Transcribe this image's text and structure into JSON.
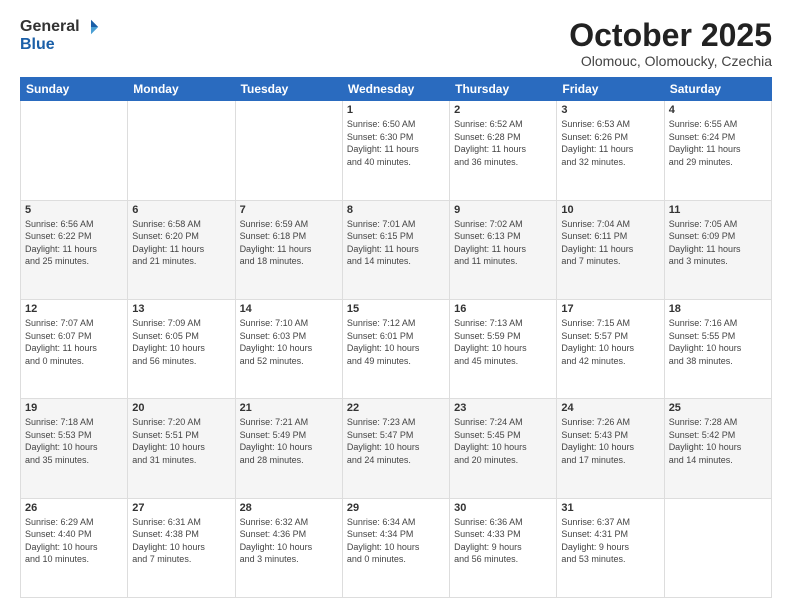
{
  "logo": {
    "general": "General",
    "blue": "Blue"
  },
  "header": {
    "month_year": "October 2025",
    "location": "Olomouc, Olomoucky, Czechia"
  },
  "days_of_week": [
    "Sunday",
    "Monday",
    "Tuesday",
    "Wednesday",
    "Thursday",
    "Friday",
    "Saturday"
  ],
  "weeks": [
    [
      {
        "day": "",
        "info": ""
      },
      {
        "day": "",
        "info": ""
      },
      {
        "day": "",
        "info": ""
      },
      {
        "day": "1",
        "info": "Sunrise: 6:50 AM\nSunset: 6:30 PM\nDaylight: 11 hours\nand 40 minutes."
      },
      {
        "day": "2",
        "info": "Sunrise: 6:52 AM\nSunset: 6:28 PM\nDaylight: 11 hours\nand 36 minutes."
      },
      {
        "day": "3",
        "info": "Sunrise: 6:53 AM\nSunset: 6:26 PM\nDaylight: 11 hours\nand 32 minutes."
      },
      {
        "day": "4",
        "info": "Sunrise: 6:55 AM\nSunset: 6:24 PM\nDaylight: 11 hours\nand 29 minutes."
      }
    ],
    [
      {
        "day": "5",
        "info": "Sunrise: 6:56 AM\nSunset: 6:22 PM\nDaylight: 11 hours\nand 25 minutes."
      },
      {
        "day": "6",
        "info": "Sunrise: 6:58 AM\nSunset: 6:20 PM\nDaylight: 11 hours\nand 21 minutes."
      },
      {
        "day": "7",
        "info": "Sunrise: 6:59 AM\nSunset: 6:18 PM\nDaylight: 11 hours\nand 18 minutes."
      },
      {
        "day": "8",
        "info": "Sunrise: 7:01 AM\nSunset: 6:15 PM\nDaylight: 11 hours\nand 14 minutes."
      },
      {
        "day": "9",
        "info": "Sunrise: 7:02 AM\nSunset: 6:13 PM\nDaylight: 11 hours\nand 11 minutes."
      },
      {
        "day": "10",
        "info": "Sunrise: 7:04 AM\nSunset: 6:11 PM\nDaylight: 11 hours\nand 7 minutes."
      },
      {
        "day": "11",
        "info": "Sunrise: 7:05 AM\nSunset: 6:09 PM\nDaylight: 11 hours\nand 3 minutes."
      }
    ],
    [
      {
        "day": "12",
        "info": "Sunrise: 7:07 AM\nSunset: 6:07 PM\nDaylight: 11 hours\nand 0 minutes."
      },
      {
        "day": "13",
        "info": "Sunrise: 7:09 AM\nSunset: 6:05 PM\nDaylight: 10 hours\nand 56 minutes."
      },
      {
        "day": "14",
        "info": "Sunrise: 7:10 AM\nSunset: 6:03 PM\nDaylight: 10 hours\nand 52 minutes."
      },
      {
        "day": "15",
        "info": "Sunrise: 7:12 AM\nSunset: 6:01 PM\nDaylight: 10 hours\nand 49 minutes."
      },
      {
        "day": "16",
        "info": "Sunrise: 7:13 AM\nSunset: 5:59 PM\nDaylight: 10 hours\nand 45 minutes."
      },
      {
        "day": "17",
        "info": "Sunrise: 7:15 AM\nSunset: 5:57 PM\nDaylight: 10 hours\nand 42 minutes."
      },
      {
        "day": "18",
        "info": "Sunrise: 7:16 AM\nSunset: 5:55 PM\nDaylight: 10 hours\nand 38 minutes."
      }
    ],
    [
      {
        "day": "19",
        "info": "Sunrise: 7:18 AM\nSunset: 5:53 PM\nDaylight: 10 hours\nand 35 minutes."
      },
      {
        "day": "20",
        "info": "Sunrise: 7:20 AM\nSunset: 5:51 PM\nDaylight: 10 hours\nand 31 minutes."
      },
      {
        "day": "21",
        "info": "Sunrise: 7:21 AM\nSunset: 5:49 PM\nDaylight: 10 hours\nand 28 minutes."
      },
      {
        "day": "22",
        "info": "Sunrise: 7:23 AM\nSunset: 5:47 PM\nDaylight: 10 hours\nand 24 minutes."
      },
      {
        "day": "23",
        "info": "Sunrise: 7:24 AM\nSunset: 5:45 PM\nDaylight: 10 hours\nand 20 minutes."
      },
      {
        "day": "24",
        "info": "Sunrise: 7:26 AM\nSunset: 5:43 PM\nDaylight: 10 hours\nand 17 minutes."
      },
      {
        "day": "25",
        "info": "Sunrise: 7:28 AM\nSunset: 5:42 PM\nDaylight: 10 hours\nand 14 minutes."
      }
    ],
    [
      {
        "day": "26",
        "info": "Sunrise: 6:29 AM\nSunset: 4:40 PM\nDaylight: 10 hours\nand 10 minutes."
      },
      {
        "day": "27",
        "info": "Sunrise: 6:31 AM\nSunset: 4:38 PM\nDaylight: 10 hours\nand 7 minutes."
      },
      {
        "day": "28",
        "info": "Sunrise: 6:32 AM\nSunset: 4:36 PM\nDaylight: 10 hours\nand 3 minutes."
      },
      {
        "day": "29",
        "info": "Sunrise: 6:34 AM\nSunset: 4:34 PM\nDaylight: 10 hours\nand 0 minutes."
      },
      {
        "day": "30",
        "info": "Sunrise: 6:36 AM\nSunset: 4:33 PM\nDaylight: 9 hours\nand 56 minutes."
      },
      {
        "day": "31",
        "info": "Sunrise: 6:37 AM\nSunset: 4:31 PM\nDaylight: 9 hours\nand 53 minutes."
      },
      {
        "day": "",
        "info": ""
      }
    ]
  ]
}
